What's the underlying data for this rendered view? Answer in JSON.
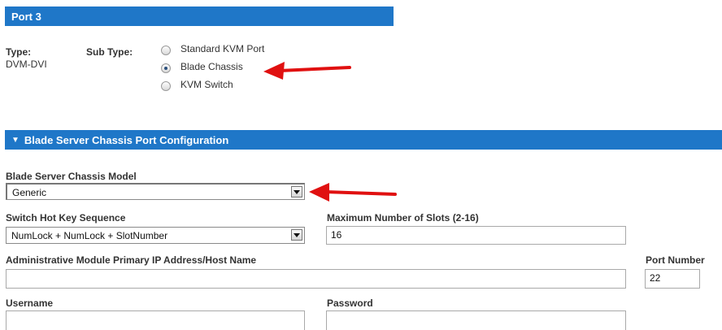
{
  "port_header": {
    "title": "Port 3"
  },
  "type": {
    "label": "Type:",
    "value": "DVM-DVI"
  },
  "subtype": {
    "label": "Sub Type:",
    "options": [
      "Standard KVM Port",
      "Blade Chassis",
      "KVM Switch"
    ],
    "selected": "Blade Chassis"
  },
  "config_header": {
    "title": "Blade Server Chassis Port Configuration"
  },
  "chassis_model": {
    "label": "Blade Server Chassis Model",
    "value": "Generic"
  },
  "hotkey": {
    "label": "Switch Hot Key Sequence",
    "value": "NumLock + NumLock + SlotNumber"
  },
  "max_slots": {
    "label": "Maximum Number of Slots (2-16)",
    "value": "16"
  },
  "admin_ip": {
    "label": "Administrative Module Primary IP Address/Host Name",
    "value": ""
  },
  "port_number": {
    "label": "Port Number",
    "value": "22"
  },
  "username": {
    "label": "Username",
    "value": ""
  },
  "password": {
    "label": "Password",
    "value": ""
  },
  "colors": {
    "header_bar": "#1f77c8",
    "arrow": "#e01010"
  }
}
